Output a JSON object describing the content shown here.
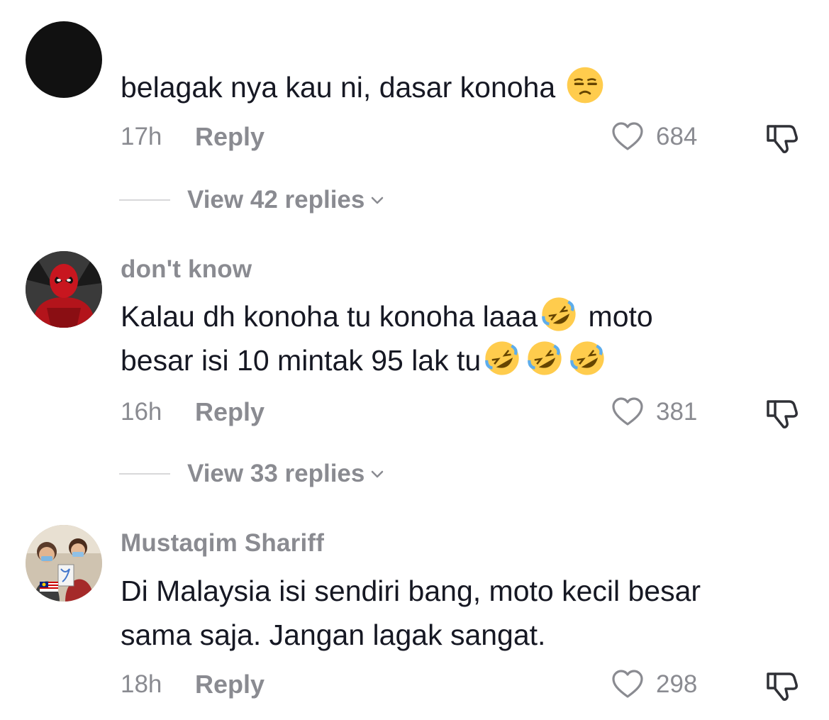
{
  "comments": [
    {
      "username": "",
      "text_parts": [
        "belagak nya kau ni, dasar konoha "
      ],
      "emojis": [
        "unamused-face"
      ],
      "time": "17h",
      "reply_label": "Reply",
      "likes": "684",
      "view_replies": "View 42 replies"
    },
    {
      "username": "don't know",
      "text_line1": "Kalau dh konoha tu konoha laaa",
      "text_line1_end": " moto",
      "text_line2": "besar isi 10 mintak 95 lak tu",
      "emojis": [
        "rolling-on-floor-laughing",
        "rolling-on-floor-laughing",
        "rolling-on-floor-laughing",
        "rolling-on-floor-laughing"
      ],
      "time": "16h",
      "reply_label": "Reply",
      "likes": "381",
      "view_replies": "View 33 replies"
    },
    {
      "username": "Mustaqim Shariff",
      "text_line1": "Di Malaysia isi sendiri bang, moto kecil besar",
      "text_line2": "sama saja. Jangan lagak sangat.",
      "time": "18h",
      "reply_label": "Reply",
      "likes": "298"
    }
  ],
  "colors": {
    "text": "#161823",
    "muted": "#8a8b91",
    "divider": "#d8d8da"
  },
  "icons": [
    "heart-outline-icon",
    "thumbs-down-icon",
    "chevron-down-icon"
  ]
}
